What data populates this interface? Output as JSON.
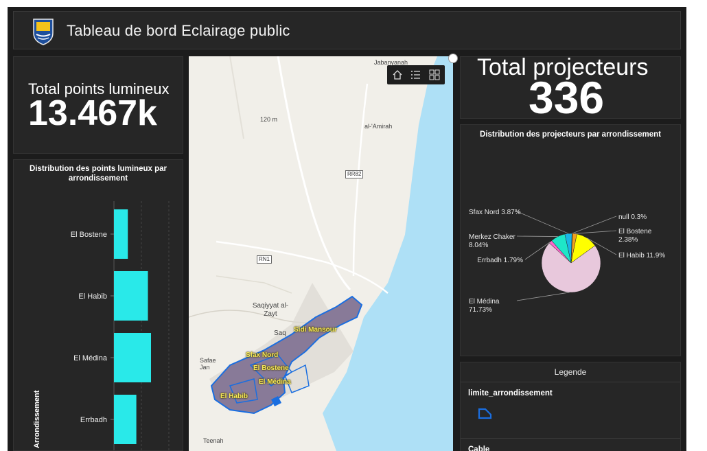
{
  "header": {
    "title": "Tableau de bord Eclairage public"
  },
  "kpi_left": {
    "label": "Total points lumineux",
    "value": "13.467k"
  },
  "kpi_right": {
    "label": "Total projecteurs",
    "value": "336"
  },
  "bar_chart": {
    "title": "Distribution des points lumineux par arrondissement",
    "axis_label": "Arrondissement",
    "bar_color": "#29e9e9",
    "chart_data": {
      "type": "bar",
      "orientation": "horizontal",
      "categories": [
        "El Bostene",
        "El Habib",
        "El Médina",
        "Errbadh"
      ],
      "values": [
        900,
        2200,
        2400,
        1450
      ],
      "xlabel": "",
      "ylabel": "Arrondissement"
    }
  },
  "pie_chart": {
    "title": "Distribution des projecteurs par arrondissement",
    "chart_data": {
      "type": "pie",
      "labels": [
        "null",
        "El Bostene",
        "El Habib",
        "El Médina",
        "Errbadh",
        "Merkez Chaker",
        "Sfax Nord"
      ],
      "values": [
        0.3,
        2.38,
        11.9,
        71.73,
        1.79,
        8.04,
        3.87
      ],
      "colors": [
        "#a86a1e",
        "#f0a020",
        "#ffff00",
        "#e8c8dc",
        "#ff66cc",
        "#1ee6c8",
        "#1ab6e6"
      ],
      "display_labels": [
        "null 0.3%",
        "El Bostene 2.38%",
        "El Habib 11.9%",
        "El Médina 71.73%",
        "Errbadh 1.79%",
        "Merkez Chaker 8.04%",
        "Sfax Nord 3.87%"
      ]
    }
  },
  "map": {
    "places": [
      "Jabanyanah",
      "120 m",
      "al-'Amirah",
      "Saqiyyat al-Zayt",
      "Teenah",
      "Safae Jan",
      "Saq"
    ],
    "roads": [
      "RR82",
      "RN1"
    ],
    "arrondissements": [
      "Sidi Mansour",
      "Sfax Nord",
      "El Bostene",
      "El Médina",
      "El Habib"
    ],
    "toolbar": [
      "home-icon",
      "list-icon",
      "basemap-icon"
    ]
  },
  "legend": {
    "title": "Legende",
    "layers": [
      "limite_arrondissement",
      "Cable"
    ],
    "symbol_color": "#1a6ee0"
  }
}
